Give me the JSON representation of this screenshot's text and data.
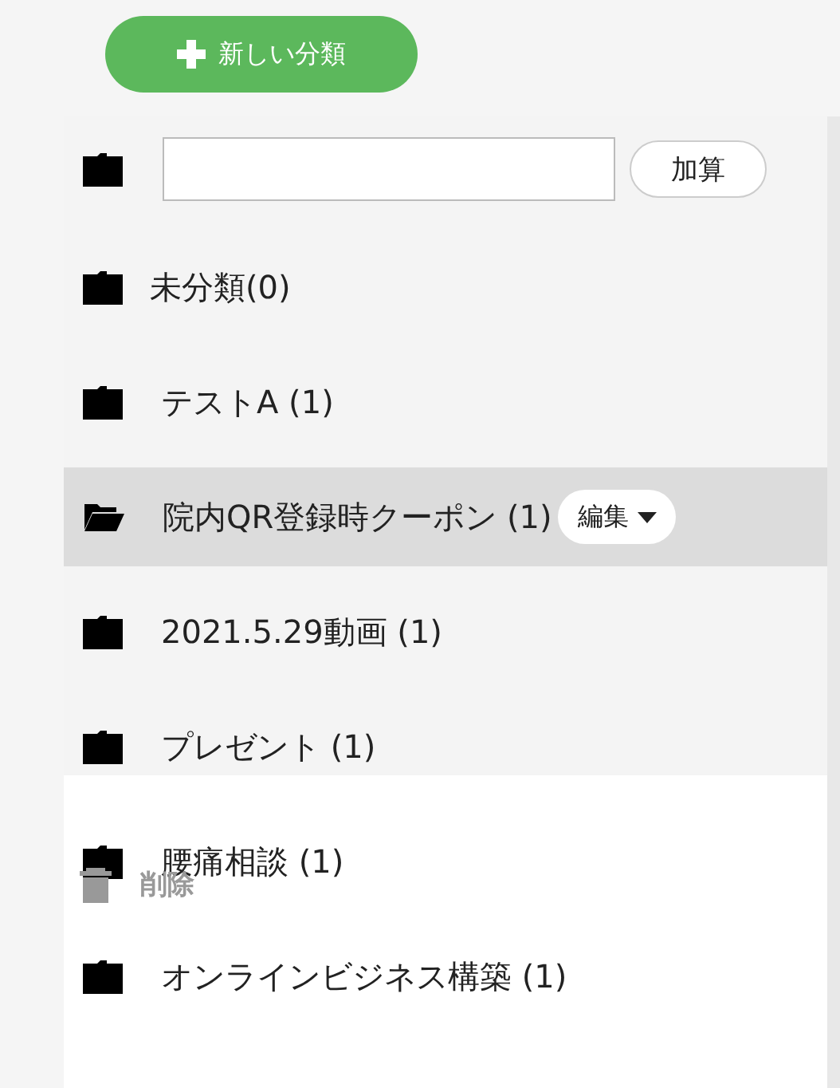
{
  "new_button": {
    "label": "新しい分類"
  },
  "add_form": {
    "button": "加算"
  },
  "categories": [
    {
      "label": "未分類(0)",
      "selected": false
    },
    {
      "label": "テストA (1)",
      "selected": false
    },
    {
      "label": "院内QR登録時クーポン (1)",
      "selected": true,
      "edit_button": "編集"
    },
    {
      "label": "2021.5.29動画 (1)",
      "selected": false
    },
    {
      "label": "プレゼント (1)",
      "selected": false
    },
    {
      "label": "腰痛相談 (1)",
      "selected": false
    },
    {
      "label": "オンラインビジネス構築 (1)",
      "selected": false
    }
  ],
  "menu": {
    "items": [
      {
        "label": "削除",
        "kind": "delete"
      }
    ]
  }
}
